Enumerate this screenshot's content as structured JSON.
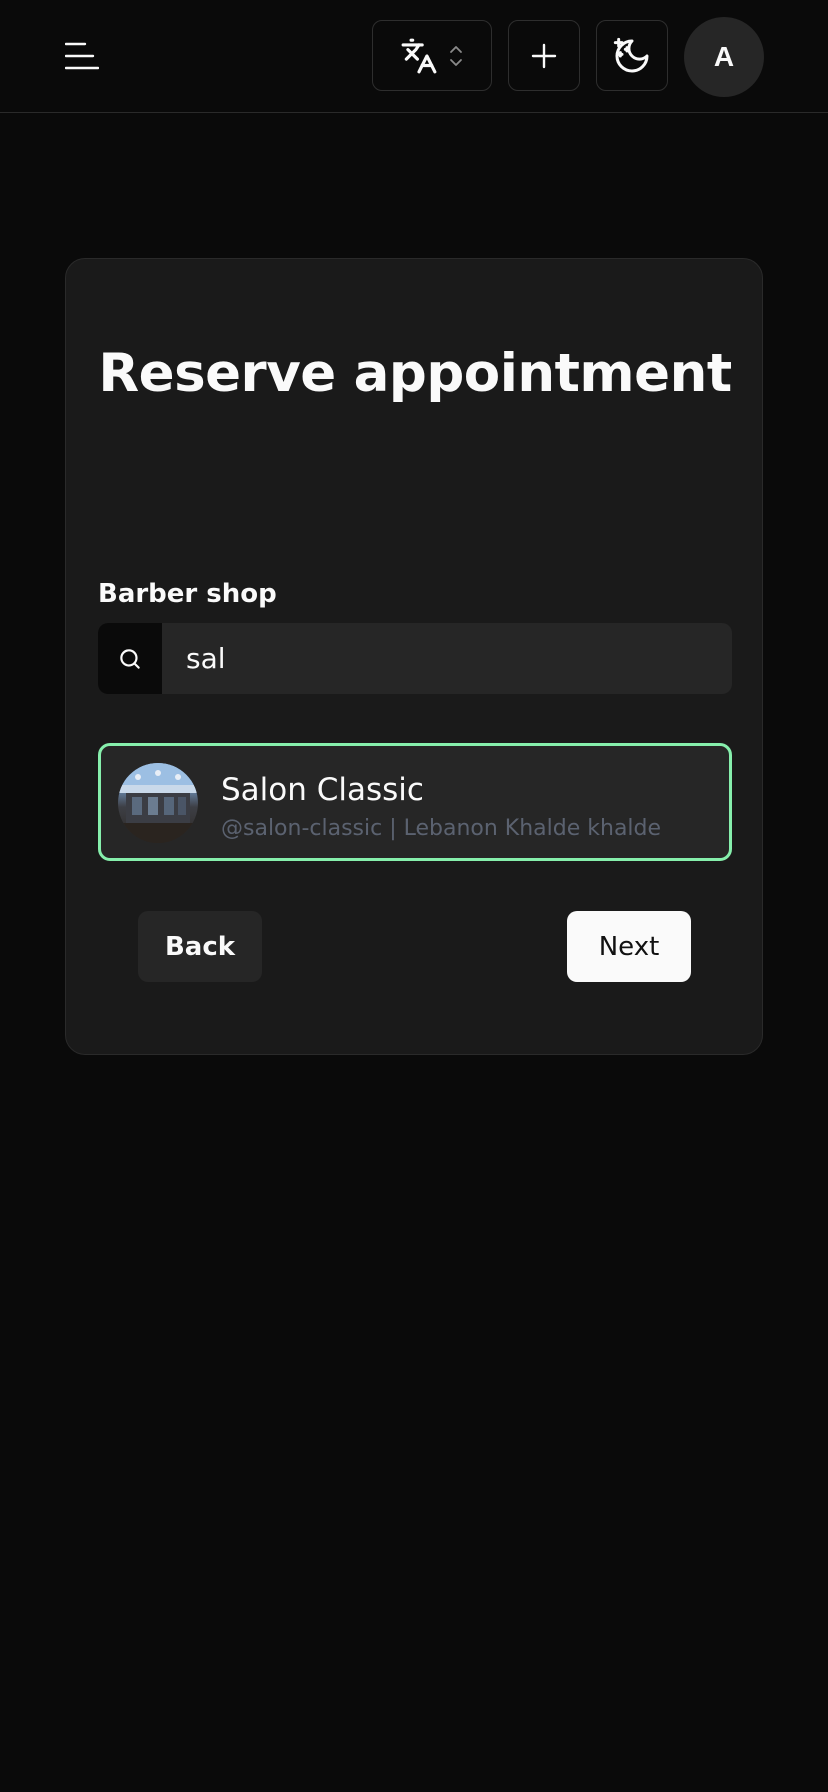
{
  "header": {
    "menu_icon": "menu-icon",
    "language_icon": "translate-icon",
    "language_chevron_icon": "chevrons-up-down-icon",
    "add_icon": "plus-icon",
    "theme_icon": "moon-stars-icon",
    "avatar_initial": "A"
  },
  "card": {
    "title": "Reserve appointment",
    "field_label": "Barber shop",
    "search": {
      "icon": "search-icon",
      "value": "sal",
      "placeholder": ""
    },
    "results": [
      {
        "name": "Salon Classic",
        "meta": "@salon-classic | Lebanon Khalde khalde",
        "selected": true
      }
    ],
    "back_label": "Back",
    "next_label": "Next"
  },
  "colors": {
    "background": "#0a0a0a",
    "card": "#1a1a1a",
    "selected_border": "#86efac",
    "muted_text": "#5b6270"
  }
}
